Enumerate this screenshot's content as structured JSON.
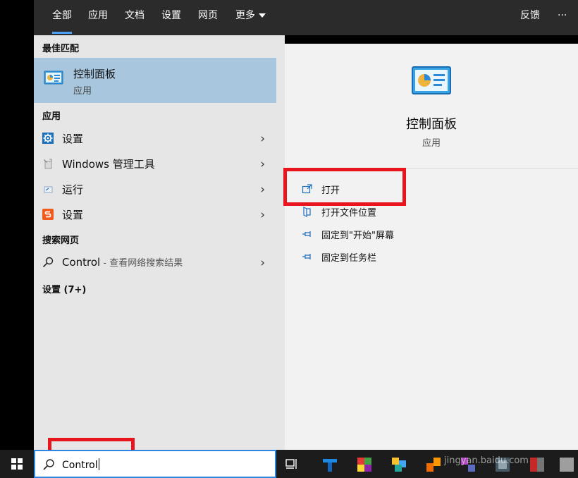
{
  "header": {
    "tabs": [
      {
        "label": "全部",
        "active": true
      },
      {
        "label": "应用"
      },
      {
        "label": "文档"
      },
      {
        "label": "设置"
      },
      {
        "label": "网页"
      },
      {
        "label": "更多"
      }
    ],
    "feedback_label": "反馈",
    "more_options_label": "···"
  },
  "left": {
    "best_match_title": "最佳匹配",
    "best_match": {
      "title": "控制面板",
      "subtitle": "应用",
      "icon": "control-panel-icon"
    },
    "apps_title": "应用",
    "apps": [
      {
        "label": "设置",
        "icon": "gear-icon"
      },
      {
        "label": "Windows 管理工具",
        "icon": "admin-tools-icon"
      },
      {
        "label": "运行",
        "icon": "run-icon"
      },
      {
        "label": "设置",
        "icon": "sogou-settings-icon"
      }
    ],
    "web_title": "搜索网页",
    "web_item": {
      "query": "Control",
      "suffix": " - 查看网络搜索结果",
      "icon": "search-icon"
    },
    "settings_more": "设置 (7+)"
  },
  "right": {
    "title": "控制面板",
    "subtitle": "应用",
    "actions": [
      {
        "label": "打开",
        "icon": "open-icon"
      },
      {
        "label": "打开文件位置",
        "icon": "file-location-icon"
      },
      {
        "label": "固定到\"开始\"屏幕",
        "icon": "pin-icon"
      },
      {
        "label": "固定到任务栏",
        "icon": "pin-icon"
      }
    ]
  },
  "search": {
    "value": "Control"
  },
  "taskbar": {
    "watermark": "jingyan.baidu.com"
  },
  "colors": {
    "accent": "#4ea0f5",
    "highlight": "#a8c7df",
    "annotation": "#e8141e",
    "header_bg": "#2b2b2b"
  }
}
